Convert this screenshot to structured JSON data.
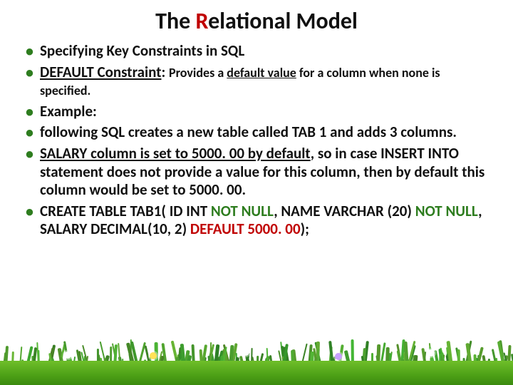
{
  "title_pre": "The ",
  "title_r": "R",
  "title_post": "elational Model",
  "b1": "Specifying Key Constraints in SQL",
  "b2_head": "DEFAULT Constraint",
  "b2_colon": ": ",
  "b2_t1": "Provides a ",
  "b2_u": "default value",
  "b2_t2": " for a column when none is specified.",
  "b3": "Example:",
  "b4": "following SQL creates a new table called TAB 1 and adds 3 columns.",
  "b5_u": "SALARY column is set to 5000. 00 by default",
  "b5_t": ", so in case INSERT INTO statement does not provide a value for this column, then by default this column would be set to 5000. 00.",
  "b6_t1": "CREATE TABLE TAB1( ID INT ",
  "b6_g1": "NOT NULL",
  "b6_t2": ", NAME VARCHAR (20) ",
  "b6_g2": "NOT NULL",
  "b6_t3": ", SALARY DECIMAL(10, 2) ",
  "b6_r": "DEFAULT 5000. 00",
  "b6_t4": ");"
}
